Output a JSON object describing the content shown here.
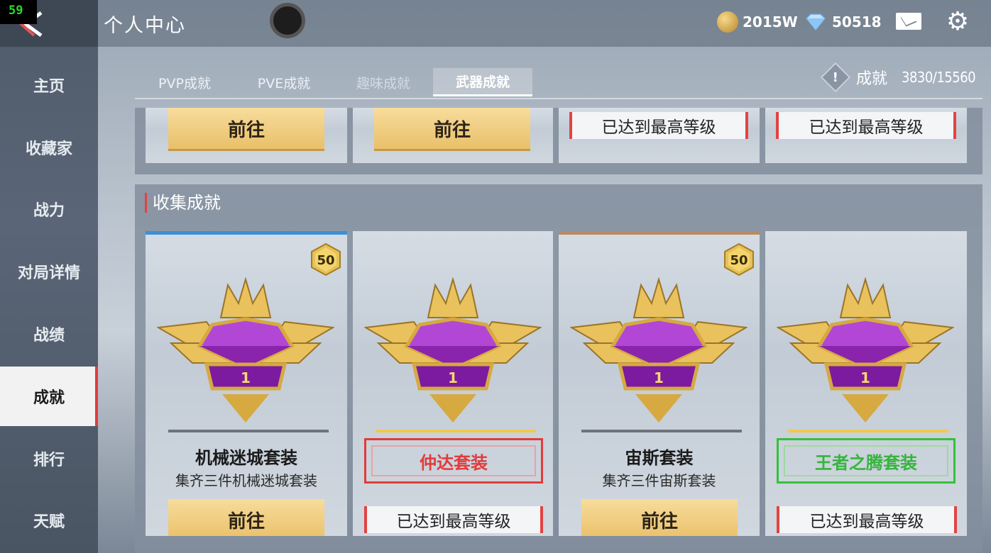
{
  "fps": "59",
  "header": {
    "title": "个人中心",
    "coins": "2015W",
    "gems": "50518"
  },
  "sidebar": {
    "items": [
      {
        "label": "主页"
      },
      {
        "label": "收藏家"
      },
      {
        "label": "战力"
      },
      {
        "label": "对局详情"
      },
      {
        "label": "战绩"
      },
      {
        "label": "成就"
      },
      {
        "label": "排行"
      },
      {
        "label": "天赋"
      }
    ]
  },
  "tabs": [
    {
      "label": "PVP成就"
    },
    {
      "label": "PVE成就"
    },
    {
      "label": "趣味成就"
    },
    {
      "label": "武器成就"
    }
  ],
  "achievement": {
    "label": "成就",
    "value": "3830/15560"
  },
  "top_row": {
    "cards": [
      {
        "button": "前往"
      },
      {
        "button": "前往"
      },
      {
        "button": "已达到最高等级"
      },
      {
        "button": "已达到最高等级"
      }
    ]
  },
  "section": {
    "title": "收集成就"
  },
  "cards": [
    {
      "level": "50",
      "name": "机械迷城套装",
      "desc": "集齐三件机械迷城套装",
      "button": "前往",
      "emblem_number": "1"
    },
    {
      "name": "仲达套装",
      "button": "已达到最高等级",
      "emblem_number": "1"
    },
    {
      "level": "50",
      "name": "宙斯套装",
      "desc": "集齐三件宙斯套装",
      "button": "前往",
      "emblem_number": "1"
    },
    {
      "name": "王者之腾套装",
      "button": "已达到最高等级",
      "emblem_number": "1"
    }
  ],
  "colors": {
    "accent_red": "#e23b3b",
    "accent_green": "#35c13c",
    "gold": "#e9c06a"
  },
  "icons": [
    "back-icon",
    "coin-icon",
    "gem-icon",
    "mail-icon",
    "gear-icon",
    "warning-icon",
    "crown-emblem-icon"
  ]
}
